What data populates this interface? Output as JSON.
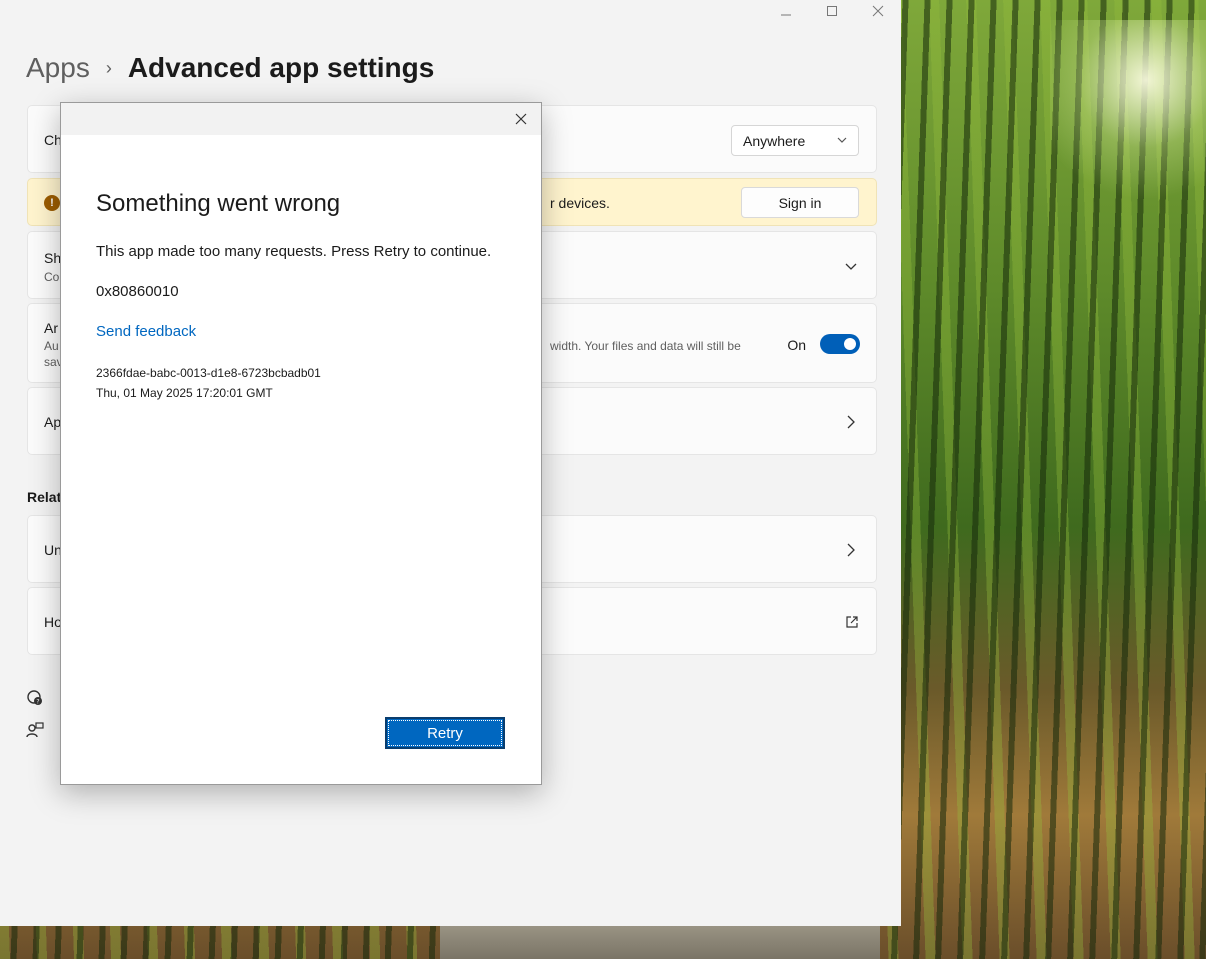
{
  "window": {
    "controls": [
      "minimize",
      "maximize",
      "close"
    ]
  },
  "breadcrumb": {
    "parent": "Apps",
    "separator": "›",
    "current": "Advanced app settings"
  },
  "settings": {
    "choose_row": {
      "title_partial": "Ch",
      "dropdown_value": "Anywhere"
    },
    "warning_row": {
      "text_partial": "r devices.",
      "button": "Sign in"
    },
    "share_row": {
      "title_partial": "Sh",
      "sub_partial": "Co"
    },
    "archive_row": {
      "title_partial": "Ar",
      "sub_partial_1": "Au",
      "sub_partial_2": "sav",
      "desc_partial": "width. Your files and data will still be",
      "toggle_label": "On",
      "toggle_on": true
    },
    "aliases_row": {
      "title_partial": "Ap"
    },
    "related_title_partial": "Relat",
    "uninstall_row": {
      "title_partial": "Un"
    },
    "howto_row": {
      "title_partial": "Ho"
    }
  },
  "dialog": {
    "heading": "Something went wrong",
    "message": "This app made too many requests. Press Retry to continue.",
    "error_code": "0x80860010",
    "feedback_link": "Send feedback",
    "correlation_id": "2366fdae-babc-0013-d1e8-6723bcbadb01",
    "timestamp": "Thu, 01 May 2025 17:20:01 GMT",
    "retry_button": "Retry"
  },
  "colors": {
    "accent": "#005fb8",
    "link": "#0067c0",
    "warning_bg": "#fff4ce",
    "warning_icon": "#9d5d00"
  }
}
